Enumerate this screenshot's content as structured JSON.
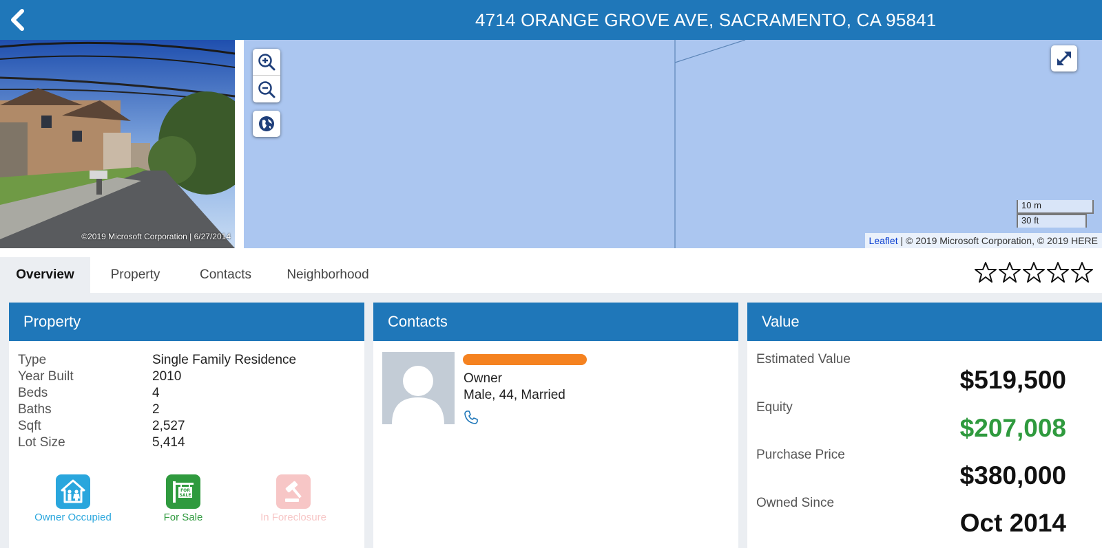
{
  "header": {
    "title": "4714 ORANGE GROVE AVE, SACRAMENTO, CA 95841",
    "back_icon": "chevron-left-icon"
  },
  "photo": {
    "credit": "©2019 Microsoft Corporation | 6/27/2014"
  },
  "map": {
    "zoom_in_icon": "zoom-in-icon",
    "zoom_out_icon": "zoom-out-icon",
    "layers_icon": "globe-icon",
    "fullscreen_icon": "expand-icon",
    "scale_metric": "10 m",
    "scale_imperial": "30 ft",
    "attribution_link": "Leaflet",
    "attribution_text": " | © 2019 Microsoft Corporation, © 2019 HERE",
    "background_color": "#abc6f0"
  },
  "tabs": [
    {
      "label": "Overview",
      "active": true
    },
    {
      "label": "Property",
      "active": false
    },
    {
      "label": "Contacts",
      "active": false
    },
    {
      "label": "Neighborhood",
      "active": false
    }
  ],
  "rating": {
    "value": 0,
    "max": 5
  },
  "property": {
    "title": "Property",
    "rows": [
      {
        "label": "Type",
        "value": "Single Family Residence"
      },
      {
        "label": "Year Built",
        "value": "2010"
      },
      {
        "label": "Beds",
        "value": "4"
      },
      {
        "label": "Baths",
        "value": "2"
      },
      {
        "label": "Sqft",
        "value": "2,527"
      },
      {
        "label": "Lot Size",
        "value": "5,414"
      }
    ],
    "badges": [
      {
        "label": "Owner Occupied",
        "icon": "house-family-icon",
        "color": "#29a6dd"
      },
      {
        "label": "For Sale",
        "icon": "for-sale-sign-icon",
        "color": "#2f9a3e"
      },
      {
        "label": "In Foreclosure",
        "icon": "gavel-icon",
        "color": "#f7c6c6"
      }
    ]
  },
  "contacts": {
    "title": "Contacts",
    "role": "Owner",
    "details": "Male, 44, Married",
    "phone_icon": "phone-icon"
  },
  "value": {
    "title": "Value",
    "items": [
      {
        "label": "Estimated Value",
        "amount": "$519,500"
      },
      {
        "label": "Equity",
        "amount": "$207,008"
      },
      {
        "label": "Purchase Price",
        "amount": "$380,000"
      },
      {
        "label": "Owned Since",
        "amount": "Oct 2014"
      }
    ]
  },
  "colors": {
    "brand": "#1f77b9",
    "equity_green": "#2f9a3e"
  }
}
